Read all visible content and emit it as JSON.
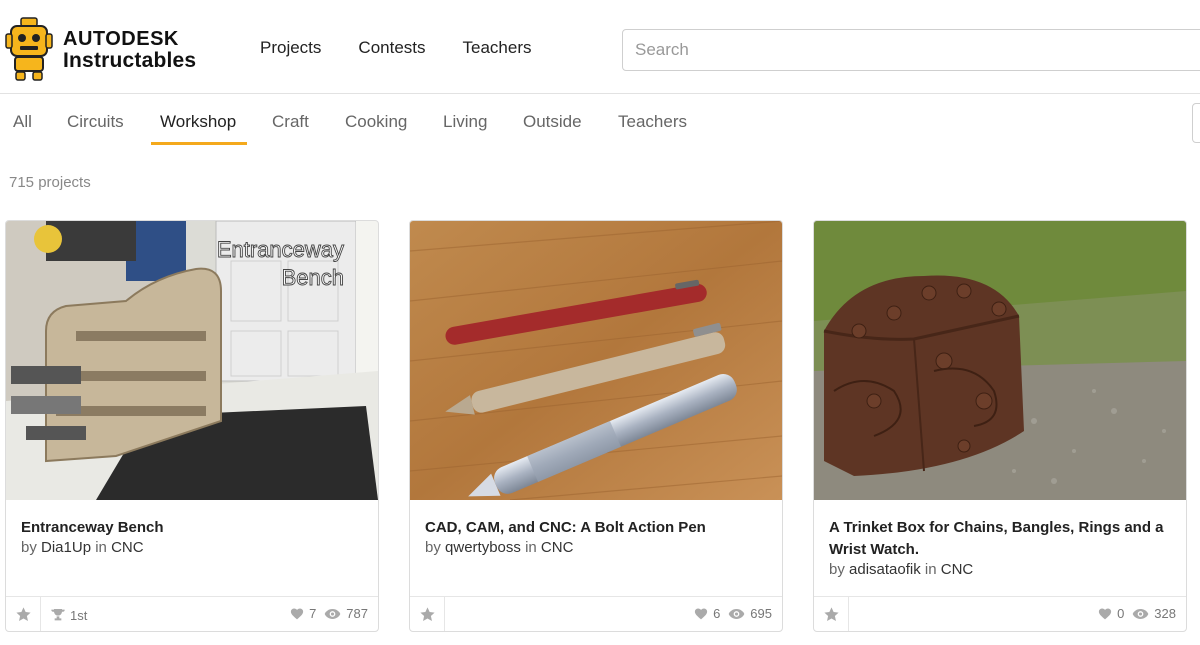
{
  "brand": {
    "line1": "AUTODESK",
    "line2": "Instructables",
    "colors": {
      "robot": "#f6b51c",
      "accent": "#f4a91c"
    }
  },
  "topnav": [
    "Projects",
    "Contests",
    "Teachers"
  ],
  "search": {
    "placeholder": "Search",
    "value": ""
  },
  "categories": [
    {
      "label": "All",
      "active": false
    },
    {
      "label": "Circuits",
      "active": false
    },
    {
      "label": "Workshop",
      "active": true
    },
    {
      "label": "Craft",
      "active": false
    },
    {
      "label": "Cooking",
      "active": false
    },
    {
      "label": "Living",
      "active": false
    },
    {
      "label": "Outside",
      "active": false
    },
    {
      "label": "Teachers",
      "active": false
    }
  ],
  "project_count": "715 projects",
  "cards": [
    {
      "title": "Entranceway Bench",
      "image_caption": "Entranceway Bench",
      "by": "by",
      "author": "Dia1Up",
      "in": "in",
      "category": "CNC",
      "prize": "1st",
      "favorites": "7",
      "views": "787"
    },
    {
      "title": "CAD, CAM, and CNC: A Bolt Action Pen",
      "by": "by",
      "author": "qwertyboss",
      "in": "in",
      "category": "CNC",
      "favorites": "6",
      "views": "695"
    },
    {
      "title": "A Trinket Box for Chains, Bangles, Rings and a Wrist Watch.",
      "by": "by",
      "author": "adisataofik",
      "in": "in",
      "category": "CNC",
      "favorites": "0",
      "views": "328"
    }
  ],
  "icons": {
    "favorite": "star-icon",
    "prize": "trophy-icon",
    "likes": "heart-icon",
    "views": "eye-icon"
  }
}
